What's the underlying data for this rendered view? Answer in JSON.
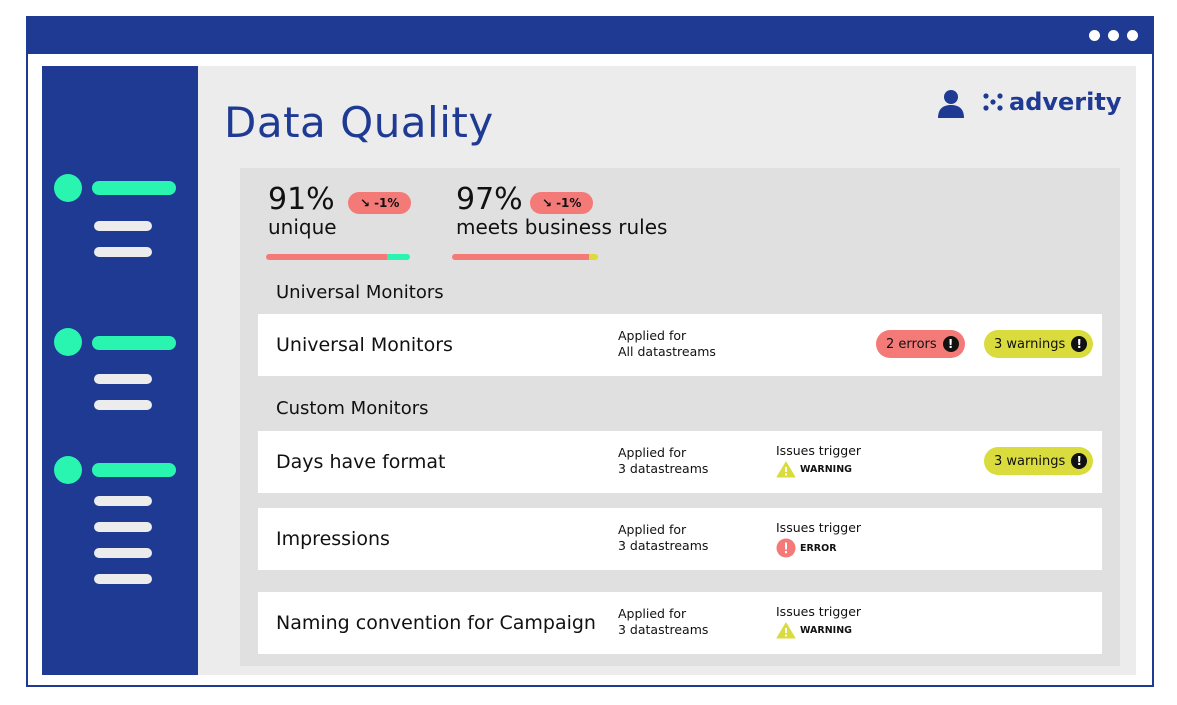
{
  "header": {
    "title": "Data Quality",
    "logo_text": "adverity",
    "brand_color": "#1f3a93",
    "accent_color": "#2af5b0"
  },
  "icons": {
    "user": "user-icon",
    "logo": "adverity-logo-icon",
    "menu": "more-dots-icon"
  },
  "stats": [
    {
      "value": "91%",
      "change": "-1%",
      "label": "unique",
      "bar": {
        "red_fraction": 0.84,
        "color2": "#2af5b0"
      }
    },
    {
      "value": "97%",
      "change": "-1%",
      "label": "meets business rules",
      "bar": {
        "red_fraction": 0.94,
        "color2": "#d9dc3c"
      }
    }
  ],
  "sections": {
    "universal_label": "Universal Monitors",
    "custom_label": "Custom Monitors"
  },
  "universal_rows": [
    {
      "name": "Universal Monitors",
      "applied_line1": "Applied for",
      "applied_line2": "All datastreams",
      "errors": "2 errors",
      "warnings": "3 warnings"
    }
  ],
  "custom_rows": [
    {
      "name": "Days have format",
      "applied_line1": "Applied for",
      "applied_line2": "3 datastreams",
      "trigger_label": "Issues trigger",
      "trigger_type": "WARNING",
      "warnings": "3 warnings"
    },
    {
      "name": "Impressions",
      "applied_line1": "Applied for",
      "applied_line2": "3 datastreams",
      "trigger_label": "Issues trigger",
      "trigger_type": "ERROR"
    },
    {
      "name": "Naming convention for Campaign",
      "applied_line1": "Applied for",
      "applied_line2": "3 datastreams",
      "trigger_label": "Issues trigger",
      "trigger_type": "WARNING"
    }
  ]
}
